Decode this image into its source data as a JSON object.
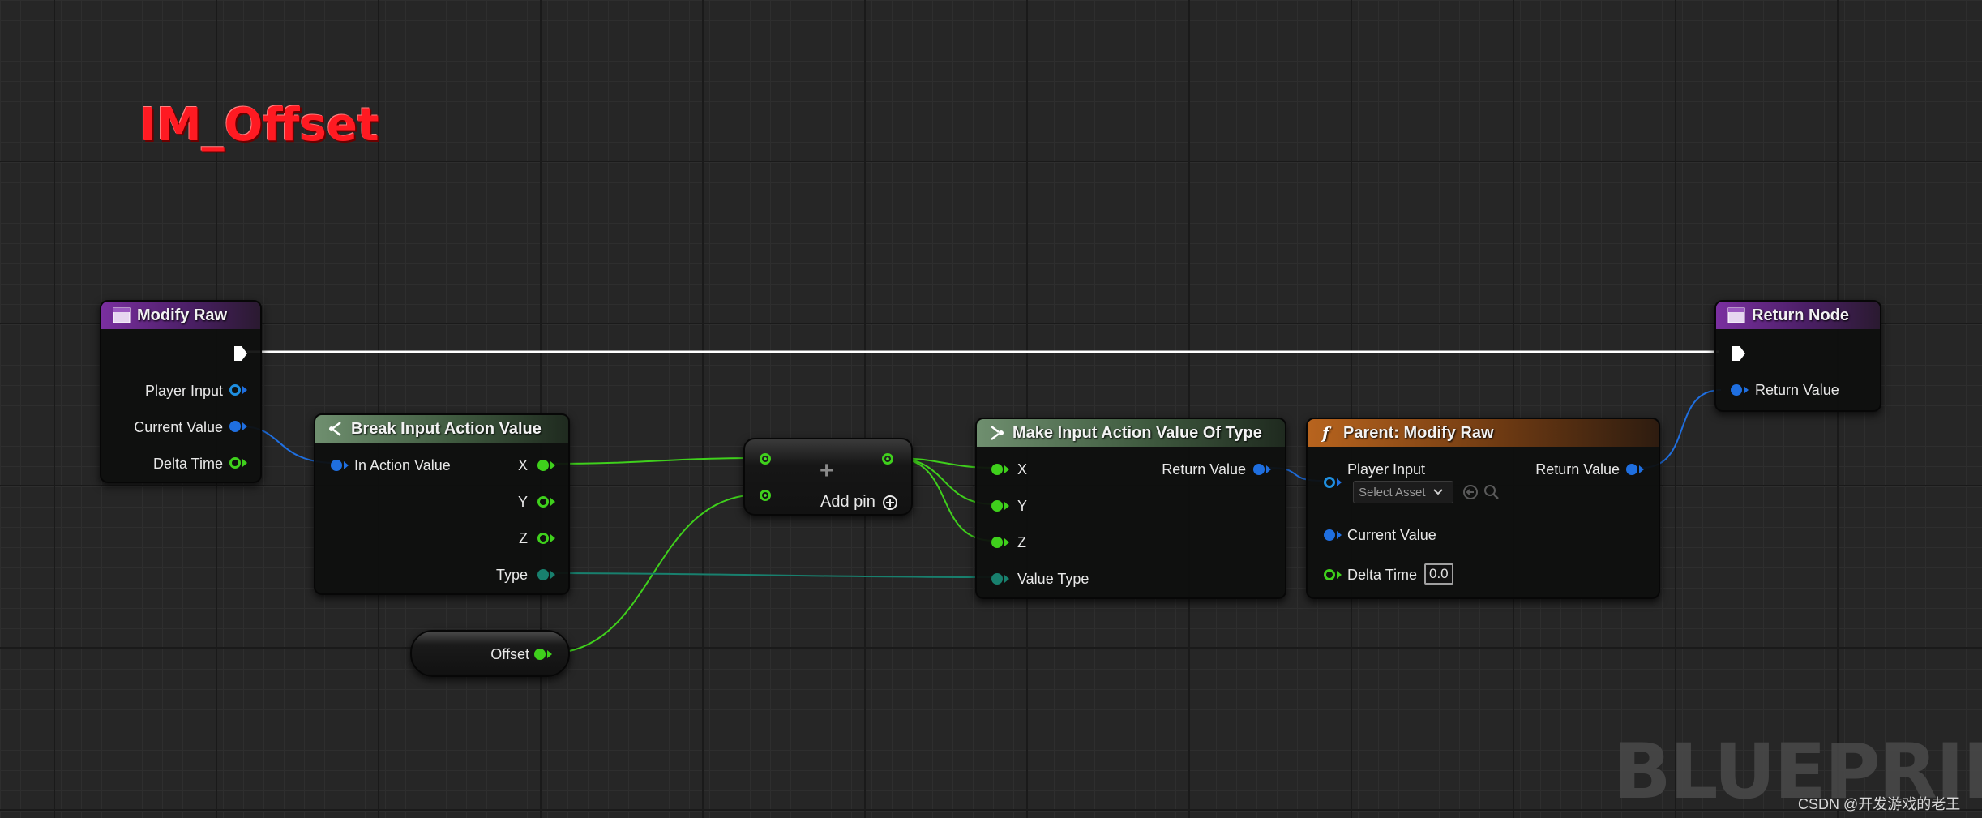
{
  "graph_title": "IM_Offset",
  "colors": {
    "exec_wire": "#ffffff",
    "struct_wire": "#1f6fe0",
    "float_wire": "#3fd01c",
    "enum_wire": "#18806e",
    "title": "#ff1a22"
  },
  "nodes": {
    "modify_raw": {
      "title": "Modify Raw",
      "icon": "event-icon",
      "pins": {
        "player_input": "Player Input",
        "current_value": "Current Value",
        "delta_time": "Delta Time"
      }
    },
    "break_input": {
      "title": "Break Input Action Value",
      "icon": "break-struct-icon",
      "pins": {
        "in_action_value": "In Action Value",
        "x": "X",
        "y": "Y",
        "z": "Z",
        "type": "Type"
      }
    },
    "add_node": {
      "symbol": "+",
      "add_pin_label": "Add pin"
    },
    "make_input": {
      "title": "Make Input Action Value Of Type",
      "icon": "make-struct-icon",
      "pins": {
        "x": "X",
        "y": "Y",
        "z": "Z",
        "value_type": "Value Type",
        "return_value": "Return Value"
      }
    },
    "parent_modify": {
      "title": "Parent: Modify Raw",
      "icon": "function-icon",
      "pins": {
        "player_input": "Player Input",
        "select_asset": "Select Asset",
        "current_value": "Current Value",
        "delta_time": "Delta Time",
        "delta_time_value": "0.0",
        "return_value": "Return Value"
      }
    },
    "return_node": {
      "title": "Return Node",
      "icon": "event-icon",
      "pins": {
        "return_value": "Return Value"
      }
    },
    "offset_var": {
      "label": "Offset"
    }
  },
  "watermark": {
    "blueprint": "BLUEPRINT",
    "csdn": "CSDN @开发游戏的老王"
  }
}
